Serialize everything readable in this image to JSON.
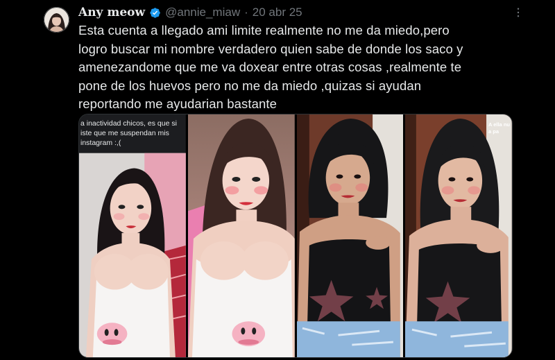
{
  "author": {
    "display_name": "Any meow",
    "handle": "@annie_miaw",
    "separator": "·",
    "date": "20 abr 25",
    "verified": true,
    "avatar_icon": "avatar-photo"
  },
  "tweet": {
    "text": "Esta cuenta a llegado ami limite realmente no me da miedo,pero\nlogro buscar mi nombre verdadero quien sabe de donde los saco y\namenezandome que me va doxear entre otras cosas ,realmente te\npone de los huevos pero no me da miedo ,quizas si ayudan\nreportando me ayudarian bastante"
  },
  "media": {
    "photo1_caption": "a inactividad chicos, es que si\niste que me suspendan mis\ninstagram :,(",
    "photo4_caption": "A ella nu\na pa"
  },
  "icons": {
    "verified": "verified-badge-icon",
    "more": "more-options-icon"
  },
  "colors": {
    "background": "#000000",
    "text_primary": "#e7e9ea",
    "text_secondary": "#71767b",
    "verified_blue": "#1d9bf0",
    "border": "#2f3336"
  }
}
